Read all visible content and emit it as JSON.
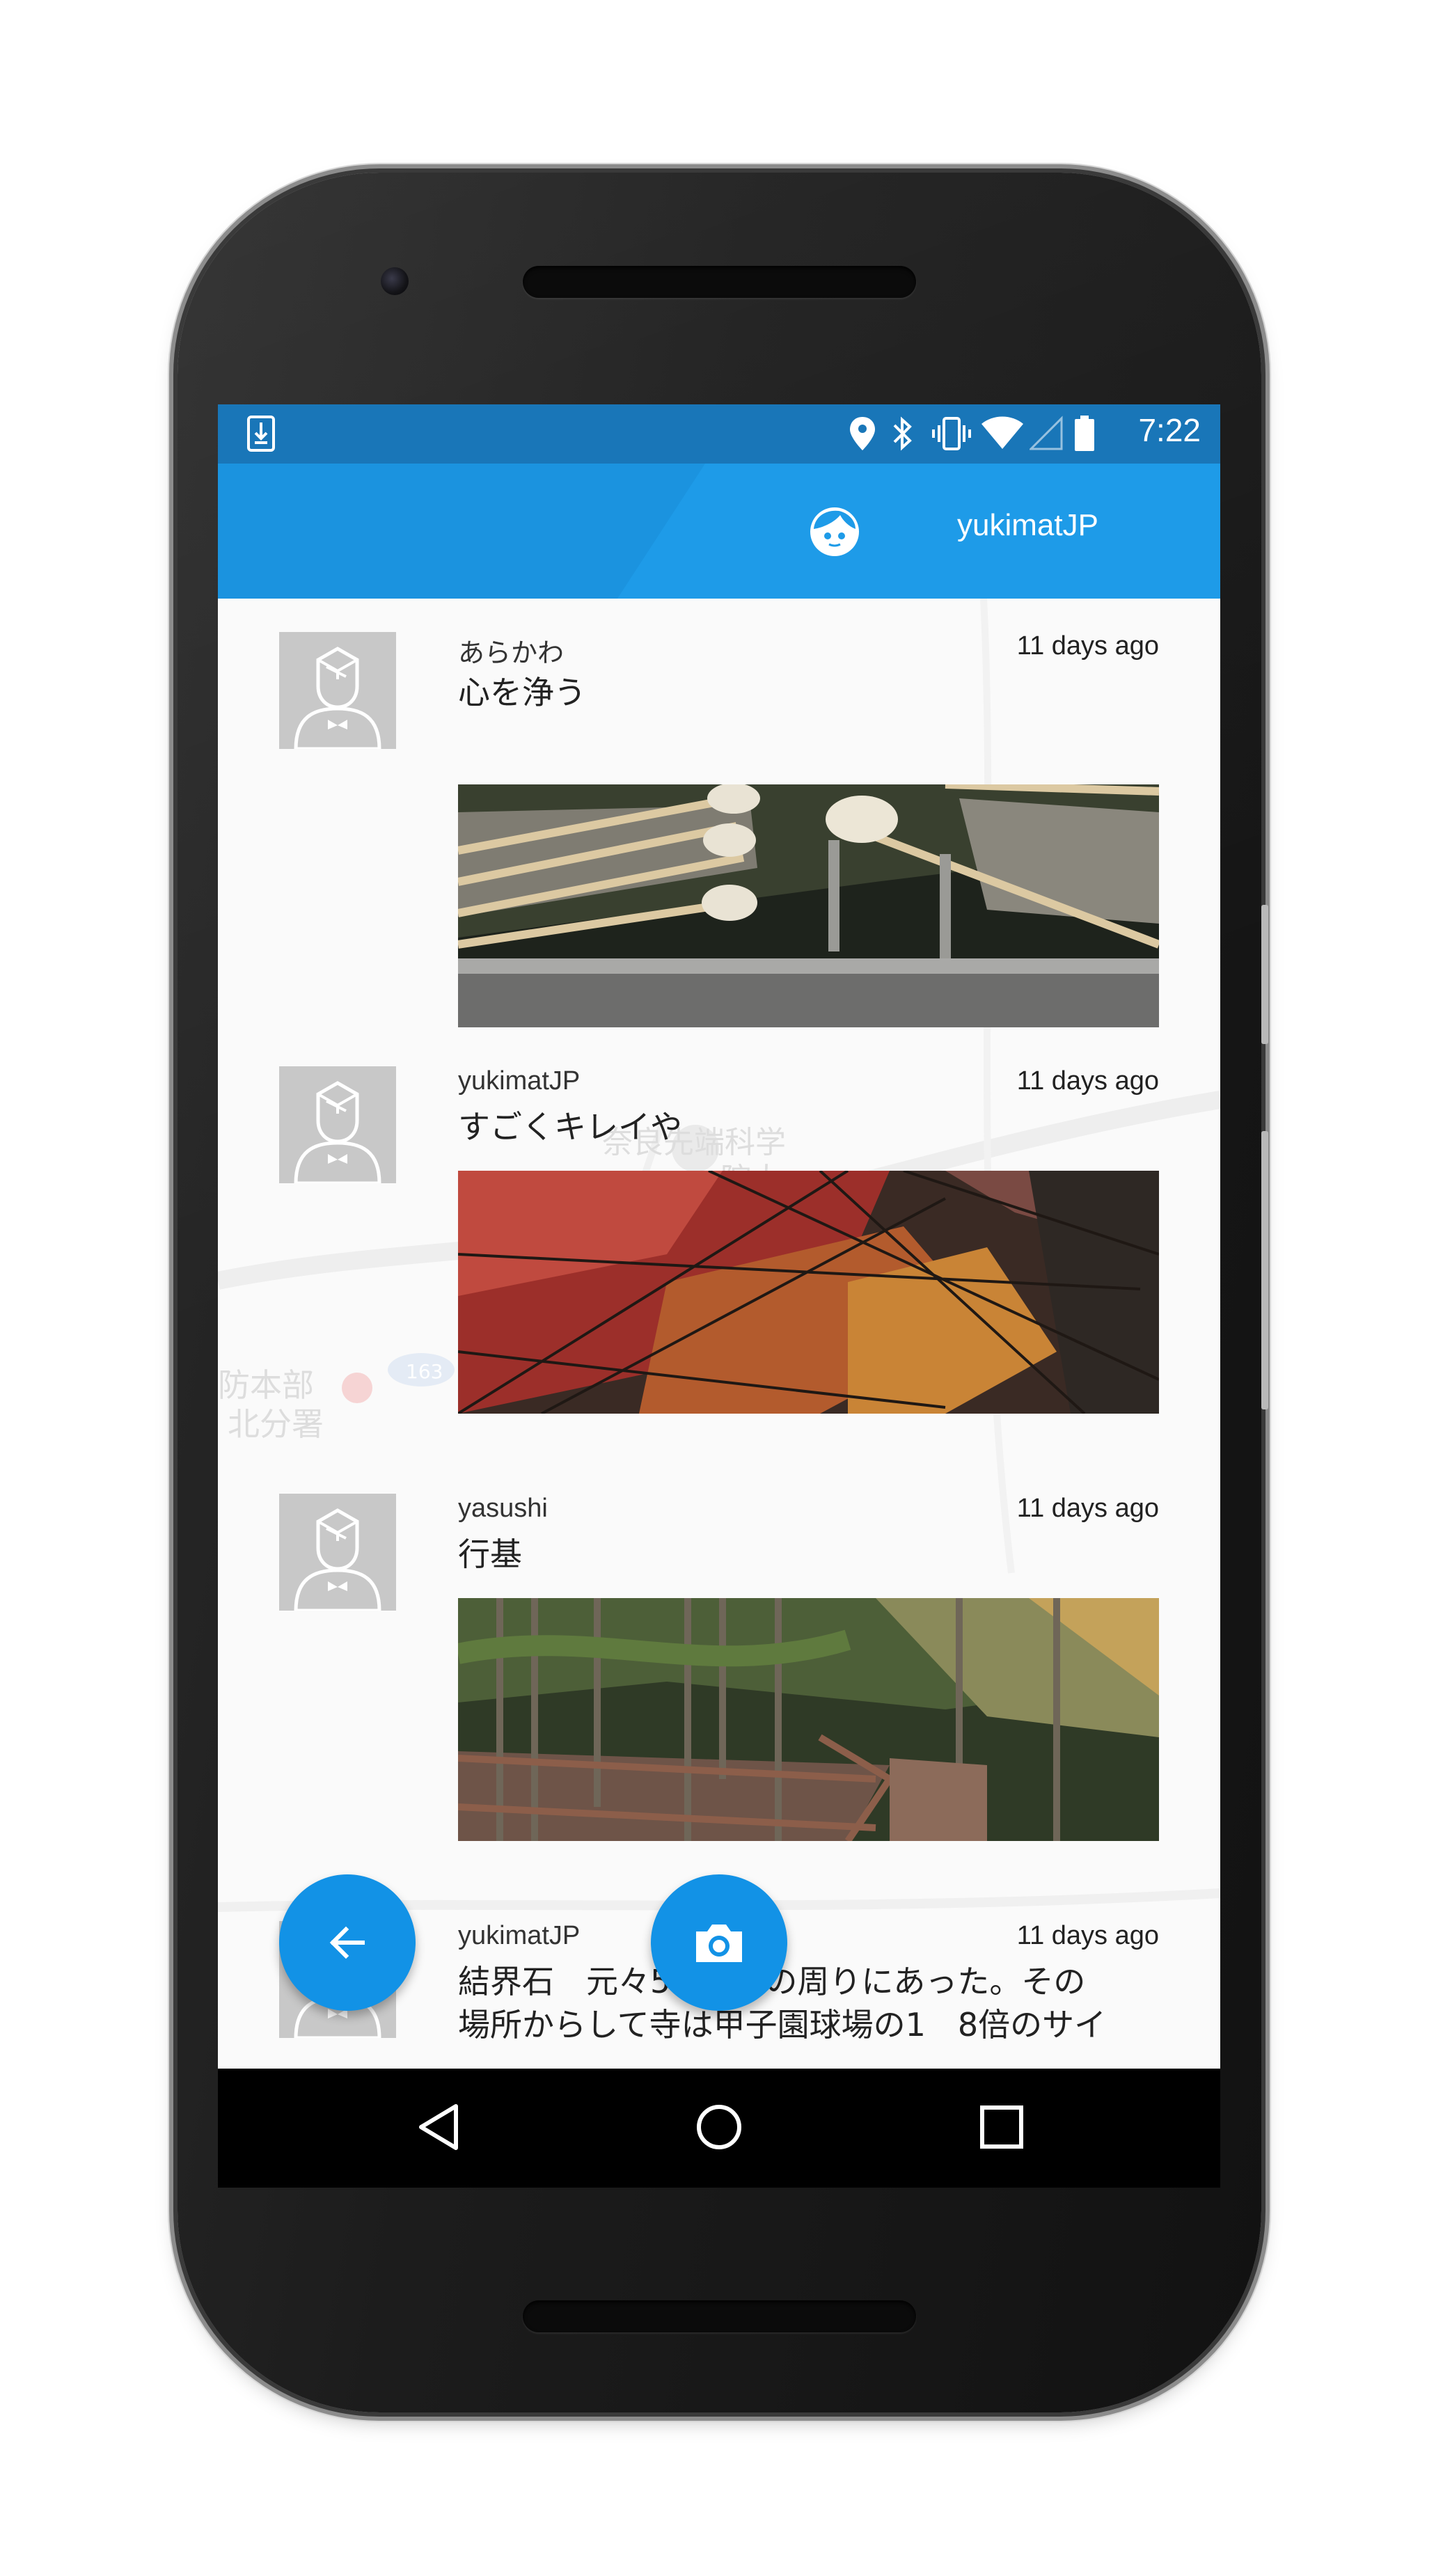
{
  "status_bar": {
    "time": "7:22",
    "icons": [
      "download-icon",
      "location-icon",
      "bluetooth-icon",
      "vibrate-icon",
      "wifi-icon",
      "cell-signal-icon",
      "battery-icon"
    ]
  },
  "app_bar": {
    "account_icon": "face-icon",
    "username": "yukimatJP",
    "color": "#1e9be8"
  },
  "feed": {
    "background_map_labels": [
      "奈良先端科学",
      "院大",
      "防本部",
      "北分署",
      "163"
    ],
    "posts": [
      {
        "author": "あらかわ",
        "time": "11 days ago",
        "text": "心を浄う",
        "photo": "temizuya-ladles-photo"
      },
      {
        "author": "yukimatJP",
        "time": "11 days ago",
        "text": "すごくキレイや",
        "photo": "autumn-maple-photo"
      },
      {
        "author": "yasushi",
        "time": "11 days ago",
        "text": "行基",
        "photo": "forest-path-photo"
      },
      {
        "author": "yukimatJP",
        "time": "11 days ago",
        "text": "結界石　元々5つ、寺の周りにあった。その",
        "text_line2": "場所からして寺は甲子園球場の1　8倍のサイ"
      }
    ]
  },
  "fabs": {
    "back_icon": "arrow-back-icon",
    "camera_icon": "camera-icon",
    "color": "#1292e6"
  },
  "nav_bar": {
    "icons": [
      "back-triangle-icon",
      "home-circle-icon",
      "recents-square-icon"
    ]
  }
}
